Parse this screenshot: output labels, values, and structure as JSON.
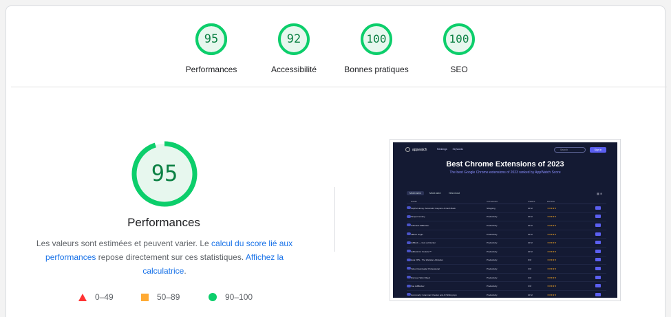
{
  "categories": [
    {
      "score": "95",
      "label": "Performances",
      "value": 95
    },
    {
      "score": "92",
      "label": "Accessibilité",
      "value": 92
    },
    {
      "score": "100",
      "label": "Bonnes pratiques",
      "value": 100
    },
    {
      "score": "100",
      "label": "SEO",
      "value": 100
    }
  ],
  "main": {
    "score": "95",
    "value": 95,
    "title": "Performances",
    "desc_part1": "Les valeurs sont estimées et peuvent varier. Le ",
    "desc_link1": "calcul du score lié aux performances",
    "desc_part2": " repose directement sur ces statistiques. ",
    "desc_link2": "Affichez la calculatrice",
    "desc_part3": "."
  },
  "legend": [
    {
      "range": "0–49",
      "color": "#ff3333",
      "shape": "triangle"
    },
    {
      "range": "50–89",
      "color": "#ffaa33",
      "shape": "square"
    },
    {
      "range": "90–100",
      "color": "#0cce6b",
      "shape": "circle"
    }
  ],
  "colors": {
    "pass": "#0cce6b",
    "pass_text": "#0b8043",
    "pass_bg": "#e7f7ee"
  },
  "screenshot": {
    "logo": "appwatch",
    "links": [
      "Rankings",
      "Keywords"
    ],
    "search": "Search",
    "signin": "Sign in",
    "title": "Best Chrome Extensions of 2023",
    "subtitle": "The best Google Chrome extensions of 2023 ranked by AppWatch Score",
    "tabs": [
      "Most users",
      "Most used",
      "New most"
    ],
    "columns": [
      "NAME",
      "CATEGORY",
      "USERS",
      "RATING"
    ],
    "rows": [
      {
        "name": "PayPal Honey: Automatic Coupons & Cash Back",
        "cat": "Shopping",
        "users": "10 M"
      },
      {
        "name": "Tampermonkey",
        "cat": "Productivity",
        "users": "10 M"
      },
      {
        "name": "AdGuard AdBlocker",
        "cat": "Productivity",
        "users": "10 M"
      },
      {
        "name": "uBlock Origin",
        "cat": "Productivity",
        "users": "10 M"
      },
      {
        "name": "AdBlock — best ad blocker",
        "cat": "Productivity",
        "users": "10 M"
      },
      {
        "name": "Adblock for Youtube™",
        "cat": "Productivity",
        "users": "10 M"
      },
      {
        "name": "Hola VPN - The Website Unblocker",
        "cat": "Productivity",
        "users": "9 M"
      },
      {
        "name": "Video Downloader Professional",
        "cat": "Productivity",
        "users": "3 M"
      },
      {
        "name": "Discover Web Object",
        "cat": "Productivity",
        "users": "3 M"
      },
      {
        "name": "Vue AdBlocker",
        "cat": "Productivity",
        "users": "3 M"
      },
      {
        "name": "Grammarly: Grammar Checker and AI Writing App",
        "cat": "Productivity",
        "users": "10 M"
      }
    ]
  }
}
